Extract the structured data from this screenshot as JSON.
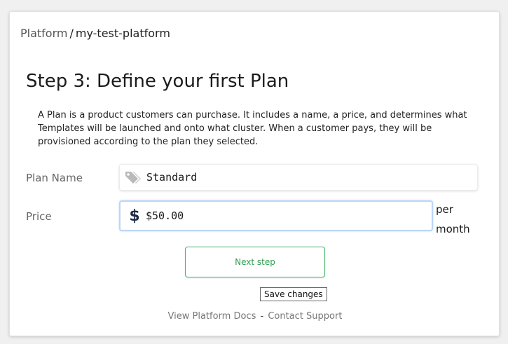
{
  "breadcrumb": {
    "root": "Platform",
    "separator": "/",
    "current": "my-test-platform"
  },
  "step": {
    "title": "Step 3: Define your first Plan",
    "description": "A Plan is a product customers can purchase. It includes a name, a price, and determines what Templates will be launched and onto what cluster. When a customer pays, they will be provisioned according to the plan they selected."
  },
  "form": {
    "plan_name": {
      "label": "Plan Name",
      "value": "Standard",
      "icon": "tags-icon"
    },
    "price": {
      "label": "Price",
      "value": "$50.00",
      "icon": "dollar-icon",
      "suffix_line1": "per",
      "suffix_line2": "month"
    }
  },
  "actions": {
    "next_label": "Next step",
    "tooltip": "Save changes"
  },
  "footer": {
    "docs_link": "View Platform Docs",
    "separator": "-",
    "support_link": "Contact Support"
  },
  "colors": {
    "accent_green": "#47b36a",
    "focus_blue": "#bcd6f6",
    "dollar_icon": "#1d2a44"
  }
}
